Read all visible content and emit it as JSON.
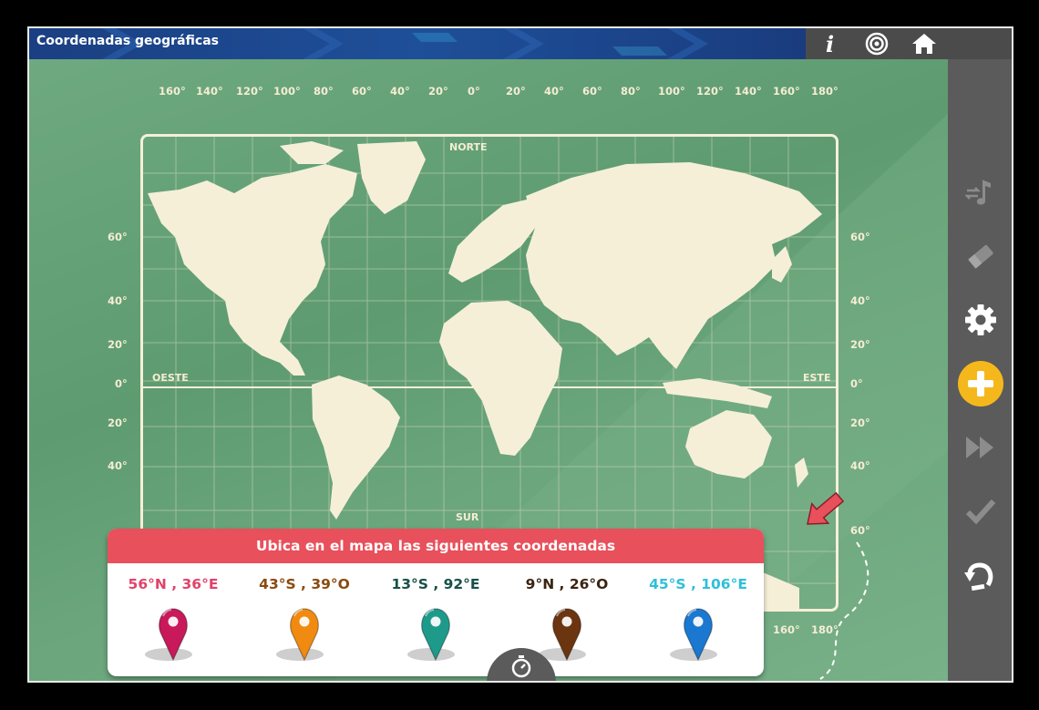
{
  "app": {
    "title": "Coordenadas geográficas"
  },
  "toolbar": {
    "info_icon": "info-icon",
    "target_icon": "target-icon",
    "home_icon": "home-icon"
  },
  "sidebar": {
    "items": [
      {
        "name": "music-icon",
        "enabled": false
      },
      {
        "name": "eraser-icon",
        "enabled": false
      },
      {
        "name": "gear-icon",
        "enabled": true
      },
      {
        "name": "plus-icon",
        "enabled": true
      },
      {
        "name": "fast-forward-icon",
        "enabled": false
      },
      {
        "name": "check-icon",
        "enabled": false
      },
      {
        "name": "undo-icon",
        "enabled": true
      }
    ]
  },
  "map": {
    "top_ticks": [
      "160°",
      "140°",
      "120°",
      "100°",
      "80°",
      "60°",
      "40°",
      "20°",
      "0°",
      "20°",
      "40°",
      "60°",
      "80°",
      "100°",
      "120°",
      "140°",
      "160°",
      "180°"
    ],
    "bottom_ticks": [
      "160°",
      "180°"
    ],
    "left_ticks": [
      "60°",
      "40°",
      "20°",
      "0°",
      "20°",
      "40°"
    ],
    "right_ticks": [
      "60°",
      "40°",
      "20°",
      "0°",
      "20°",
      "40°",
      "60°"
    ],
    "north": "NORTE",
    "south": "SUR",
    "west": "OESTE",
    "east": "ESTE"
  },
  "panel": {
    "title": "Ubica en el mapa las siguientes coordenadas",
    "coordinates": [
      {
        "text": "56°N , 36°E",
        "color": "#e0436b"
      },
      {
        "text": "43°S , 39°O",
        "color": "#8a4a10"
      },
      {
        "text": "13°S , 92°E",
        "color": "#17504a"
      },
      {
        "text": "9°N , 26°O",
        "color": "#3b2410"
      },
      {
        "text": "45°S , 106°E",
        "color": "#2fc0d8"
      }
    ],
    "pins": [
      {
        "name": "pin-magenta",
        "color": "#c8195a"
      },
      {
        "name": "pin-orange",
        "color": "#f08a10"
      },
      {
        "name": "pin-teal",
        "color": "#1e9a8a"
      },
      {
        "name": "pin-brown",
        "color": "#6b3510"
      },
      {
        "name": "pin-blue",
        "color": "#1a78d0"
      }
    ]
  },
  "footer": {
    "timer_icon": "stopwatch-icon"
  },
  "colors": {
    "map_bg": "#6aa57b",
    "land": "#f6efd8",
    "header_red": "#e8505b",
    "accent_yellow": "#f5b81c",
    "arrow_red": "#e8505b"
  }
}
